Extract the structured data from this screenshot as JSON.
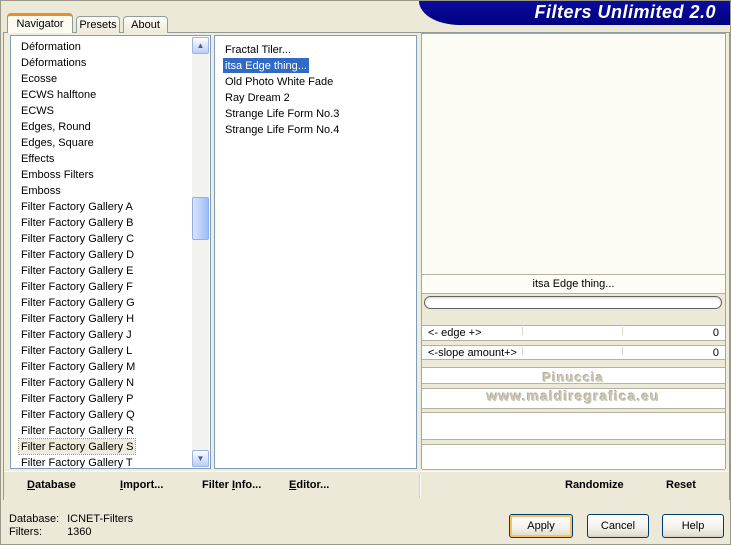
{
  "title": "Filters Unlimited 2.0",
  "tabs": [
    {
      "label": "Navigator",
      "active": true
    },
    {
      "label": "Presets",
      "active": false
    },
    {
      "label": "About",
      "active": false
    }
  ],
  "category_list": {
    "items": [
      "Déformation",
      "Déformations",
      "Ecosse",
      "ECWS halftone",
      "ECWS",
      "Edges, Round",
      "Edges, Square",
      "Effects",
      "Emboss Filters",
      "Emboss",
      "Filter Factory Gallery A",
      "Filter Factory Gallery B",
      "Filter Factory Gallery C",
      "Filter Factory Gallery D",
      "Filter Factory Gallery E",
      "Filter Factory Gallery F",
      "Filter Factory Gallery G",
      "Filter Factory Gallery H",
      "Filter Factory Gallery J",
      "Filter Factory Gallery L",
      "Filter Factory Gallery M",
      "Filter Factory Gallery N",
      "Filter Factory Gallery P",
      "Filter Factory Gallery Q",
      "Filter Factory Gallery R",
      "Filter Factory Gallery S",
      "Filter Factory Gallery T"
    ],
    "focused": "Filter Factory Gallery S"
  },
  "filter_list": {
    "items": [
      "Fractal Tiler...",
      "itsa Edge thing...",
      "Old Photo White Fade",
      "Ray Dream 2",
      "Strange Life Form No.3",
      "Strange Life Form No.4"
    ],
    "selected": "itsa Edge thing..."
  },
  "preview": {
    "caption": "itsa Edge thing...",
    "watermark_line1": "Pinuccia",
    "watermark_line2": "www.maldiregrafica.eu"
  },
  "params": [
    {
      "label": "<- edge +>",
      "value": "0"
    },
    {
      "label": "<-slope amount+>",
      "value": "0"
    }
  ],
  "toolbar": {
    "left": [
      {
        "pre": "",
        "key": "D",
        "post": "atabase"
      },
      {
        "pre": "",
        "key": "I",
        "post": "mport..."
      },
      {
        "pre": "Filter ",
        "key": "I",
        "post": "nfo..."
      },
      {
        "pre": "",
        "key": "E",
        "post": "ditor..."
      }
    ],
    "right": [
      "Randomize",
      "Reset"
    ]
  },
  "status": {
    "database_label": "Database:",
    "database_value": "ICNET-Filters",
    "filters_label": "Filters:",
    "filters_value": "1360"
  },
  "actions": [
    {
      "label": "Apply",
      "default": true
    },
    {
      "label": "Cancel",
      "default": false
    },
    {
      "label": "Help",
      "default": false
    }
  ],
  "icons": {
    "scroll_up": "▲",
    "scroll_down": "▼"
  },
  "colors": {
    "title_bg": "#000080",
    "selection_bg": "#316ac5",
    "tab_accent_orange": "#e78f30",
    "dialog_bg": "#ece9d8",
    "preview_top_blue": "#0913ea",
    "preview_bottom_gray": "#aba79a",
    "default_button_ring": "#f9c15f"
  }
}
